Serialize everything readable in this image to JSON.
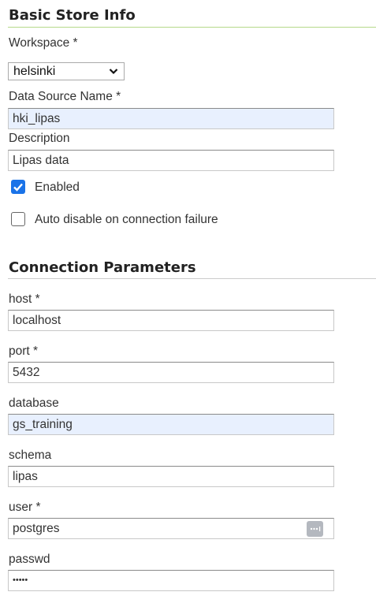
{
  "basic": {
    "title": "Basic Store Info",
    "workspace_label": "Workspace *",
    "workspace_value": "helsinki",
    "dsn_label": "Data Source Name *",
    "dsn_value": "hki_lipas",
    "desc_label": "Description",
    "desc_value": "Lipas data",
    "enabled_label": "Enabled",
    "enabled_checked": true,
    "auto_disable_label": "Auto disable on connection failure",
    "auto_disable_checked": false
  },
  "connection": {
    "title": "Connection Parameters",
    "fields": [
      {
        "label": "host *",
        "value": "localhost"
      },
      {
        "label": "port *",
        "value": "5432"
      },
      {
        "label": "database",
        "value": "gs_training"
      },
      {
        "label": "schema",
        "value": "lipas"
      },
      {
        "label": "user *",
        "value": "postgres"
      },
      {
        "label": "passwd",
        "value": "•••••"
      }
    ]
  },
  "colors": {
    "accent_rule": "#b5d98a",
    "checkbox": "#1a73e8",
    "autofill": "#e8f0fe"
  }
}
